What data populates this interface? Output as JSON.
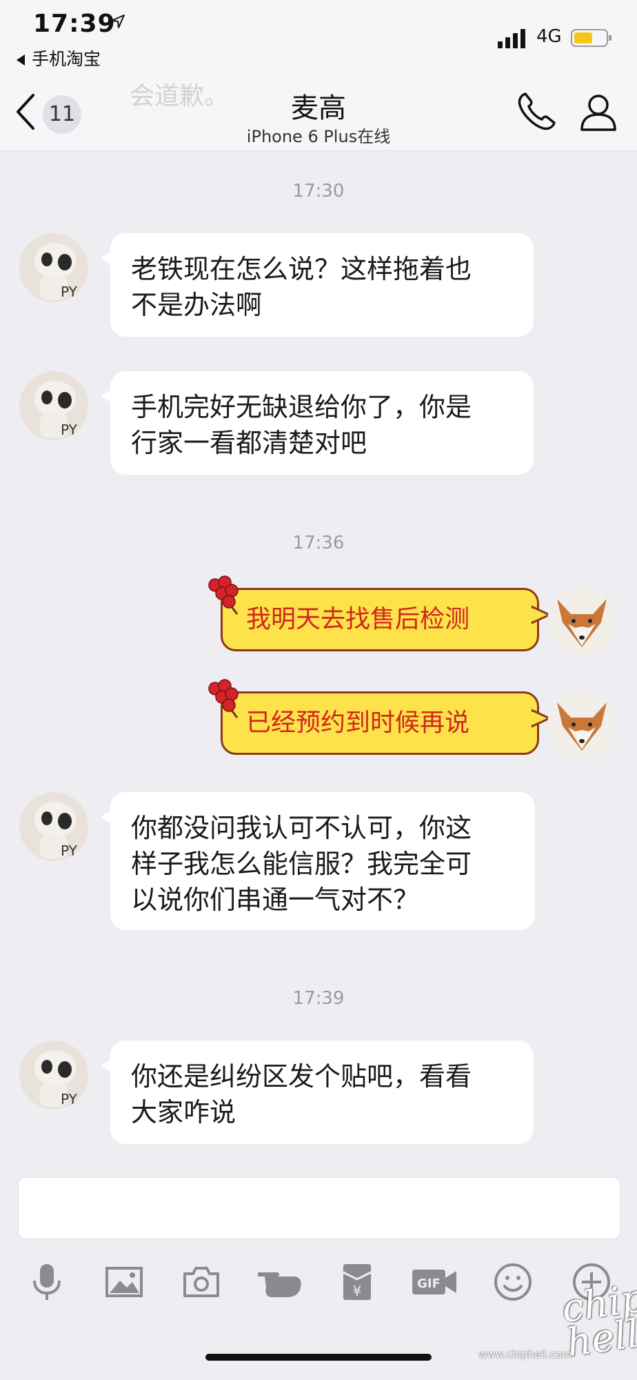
{
  "status_bar": {
    "time": "17:39",
    "back_app": "手机淘宝",
    "network": "4G"
  },
  "nav": {
    "ghost_text": "会道歉。",
    "unread_badge": "11",
    "title": "麦高",
    "subtitle": "iPhone 6 Plus在线"
  },
  "messages": [
    {
      "type": "timestamp",
      "text": "17:30"
    },
    {
      "type": "in",
      "text_line1": "老铁现在怎么说？这样拖着也",
      "text_line2": "不是办法啊"
    },
    {
      "type": "in",
      "text_line1": "手机完好无缺退给你了，你是",
      "text_line2": "行家一看都清楚对吧"
    },
    {
      "type": "timestamp",
      "text": "17:36"
    },
    {
      "type": "out",
      "text": "我明天去找售后检测"
    },
    {
      "type": "out",
      "text": "已经预约到时候再说"
    },
    {
      "type": "in",
      "text_line1": "你都没问我认可不认可，你这",
      "text_line2": "样子我怎么能信服？我完全可",
      "text_line3": "以说你们串通一气对不？"
    },
    {
      "type": "timestamp",
      "text": "17:39"
    },
    {
      "type": "in",
      "text_line1": "你还是纠纷区发个贴吧，看看",
      "text_line2": "大家咋说"
    }
  ],
  "input": {
    "value": ""
  },
  "toolbar": {
    "icons": [
      "microphone-icon",
      "image-icon",
      "camera-icon",
      "poke-icon",
      "red-packet-icon",
      "gif-icon",
      "emoji-icon",
      "plus-icon"
    ]
  },
  "watermark": {
    "logo": "chip hell",
    "url": "www.chiphell.com"
  },
  "colors": {
    "background": "#eeedf2",
    "incoming_bubble": "#ffffff",
    "outgoing_bubble": "#fde24a",
    "outgoing_text": "#d1261c",
    "icon_gray": "#8a8a90"
  }
}
